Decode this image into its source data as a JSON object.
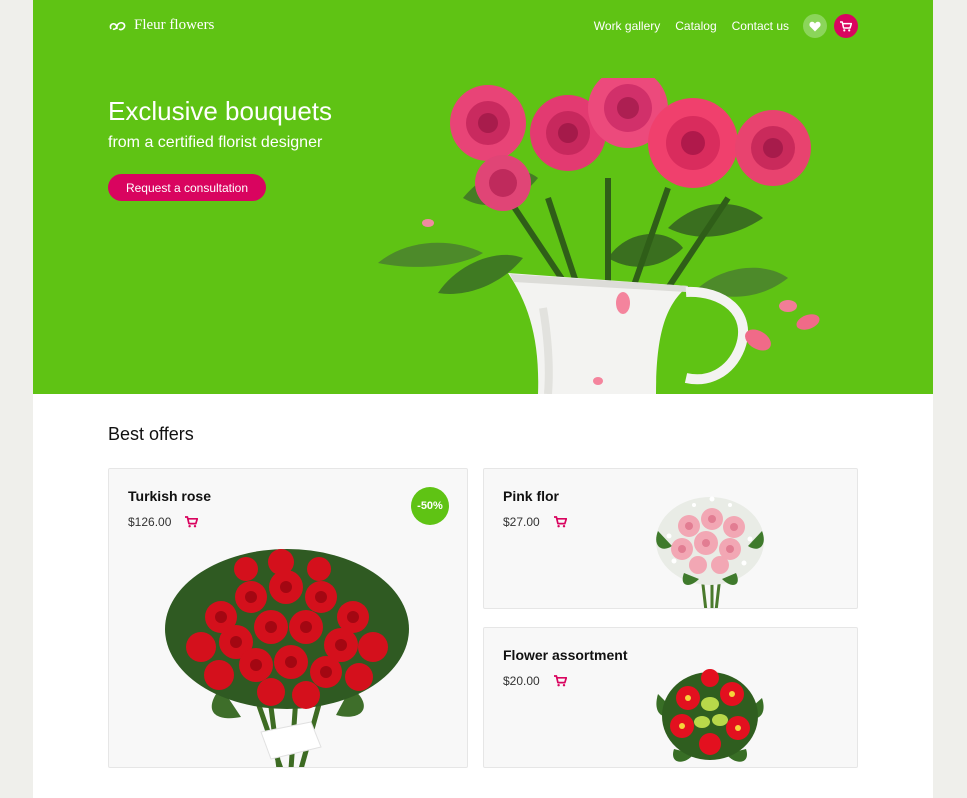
{
  "header": {
    "logo_text": "Fleur flowers",
    "nav": [
      "Work gallery",
      "Catalog",
      "Contact us"
    ],
    "icons": {
      "wishlist": "heart-icon",
      "cart": "cart-icon"
    }
  },
  "hero": {
    "title": "Exclusive bouquets",
    "subtitle": "from a certified florist designer",
    "cta_label": "Request a consultation"
  },
  "offers": {
    "title": "Best offers",
    "items": [
      {
        "name": "Turkish rose",
        "price": "$126.00",
        "badge": "-50%"
      },
      {
        "name": "Pink flor",
        "price": "$27.00"
      },
      {
        "name": "Flower assortment",
        "price": "$20.00"
      }
    ]
  },
  "colors": {
    "brand_green": "#5fc314",
    "accent_pink": "#d9045f",
    "page_bg": "#efefeb",
    "card_bg": "#f8f8f8"
  }
}
